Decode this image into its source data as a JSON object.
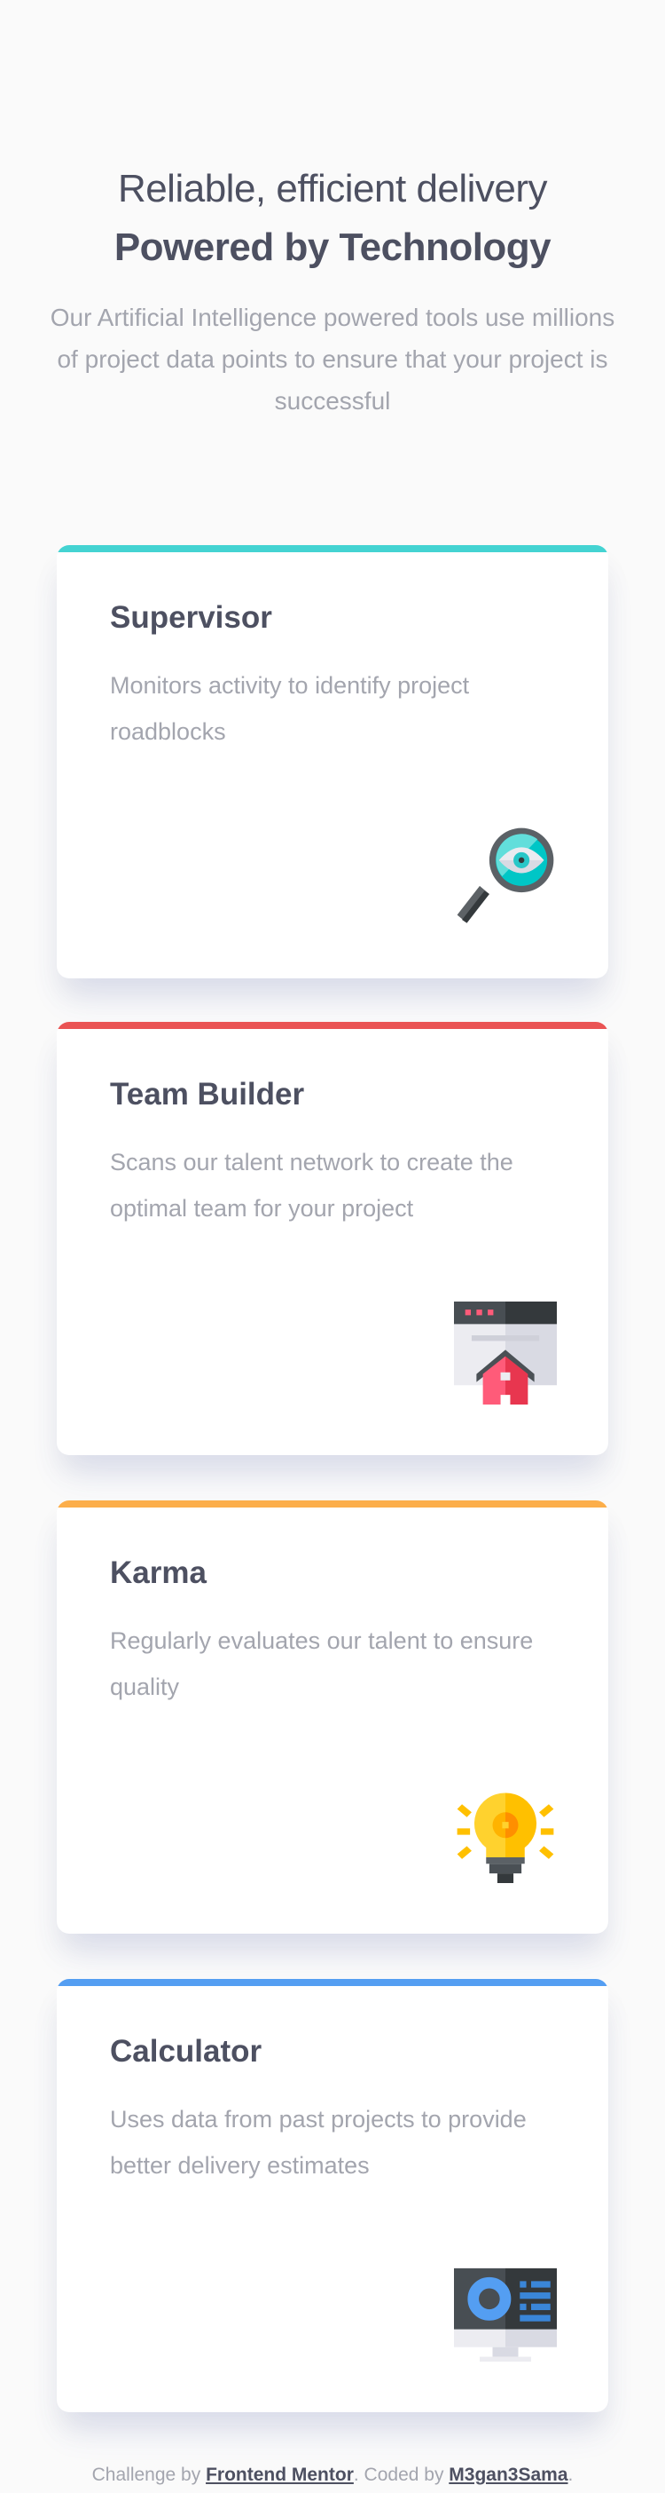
{
  "header": {
    "subtitle": "Reliable, efficient delivery",
    "title": "Powered by Technology",
    "description": "Our Artificial Intelligence powered tools use millions of project data points to ensure that your project is successful"
  },
  "cards": [
    {
      "title": "Supervisor",
      "description": "Monitors activity to identify project roadblocks",
      "accent": "#44d3d2",
      "icon": "magnifier-eye-icon"
    },
    {
      "title": "Team Builder",
      "description": "Scans our talent network to create the optimal team for your project",
      "accent": "#ea5454",
      "icon": "browser-house-icon"
    },
    {
      "title": "Karma",
      "description": "Regularly evaluates our talent to ensure quality",
      "accent": "#fcae4a",
      "icon": "lightbulb-gear-icon"
    },
    {
      "title": "Calculator",
      "description": "Uses data from past projects to provide better delivery estimates",
      "accent": "#549ef2",
      "icon": "monitor-chart-icon"
    }
  ],
  "footer": {
    "prefix": "Challenge by ",
    "link1": "Frontend Mentor",
    "middle": ". Coded by ",
    "link2": "M3gan3Sama",
    "suffix": "."
  }
}
